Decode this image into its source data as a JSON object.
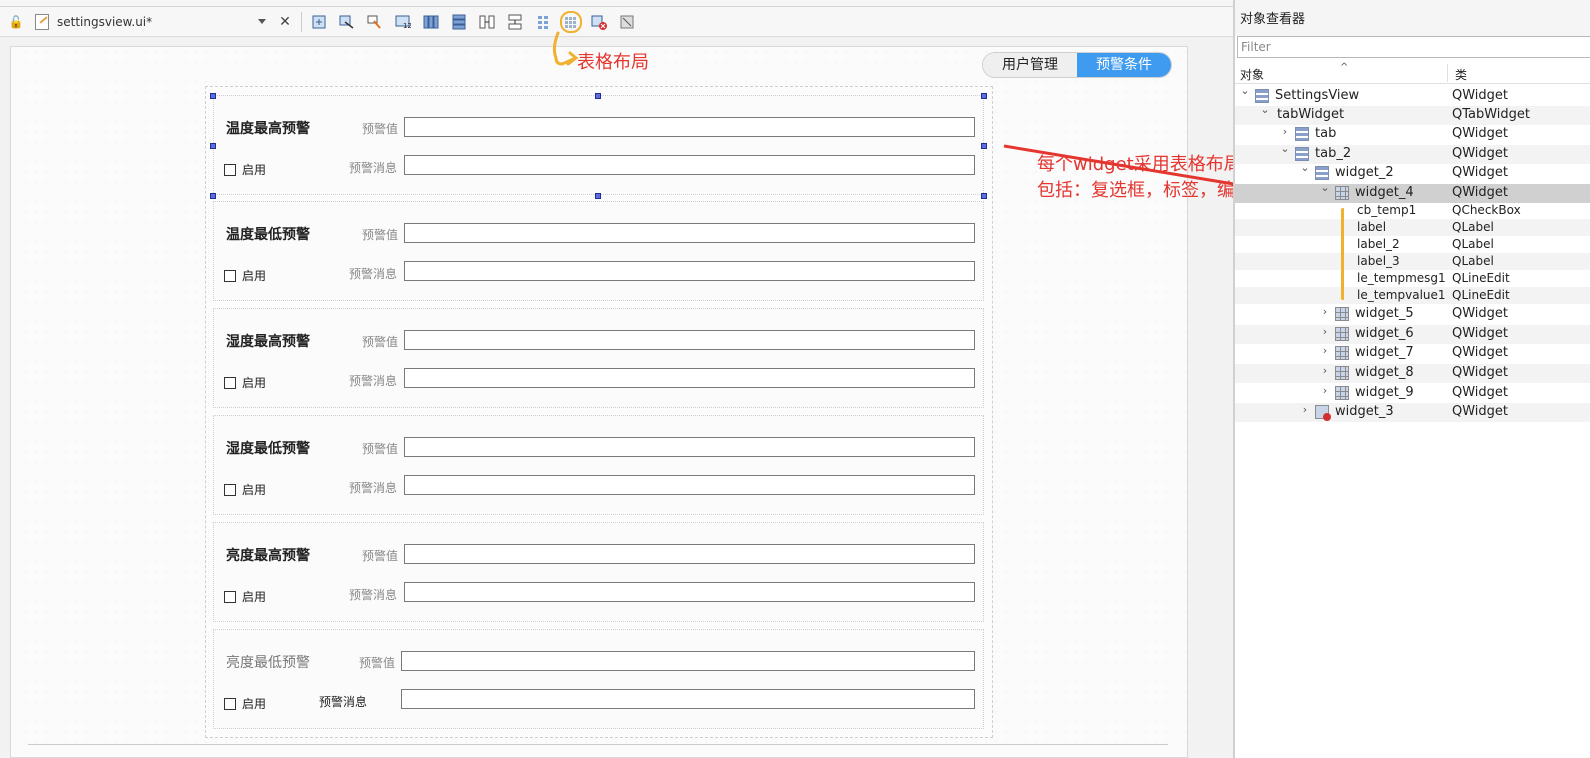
{
  "toolbar": {
    "file_name": "settingsview.ui*",
    "buttons": [
      "edit-widgets-icon",
      "edit-signals-icon",
      "edit-buddies-icon",
      "edit-tab-order-icon",
      "layout-horizontal-icon",
      "layout-vertical-icon",
      "layout-horizontal-splitter-icon",
      "layout-vertical-splitter-icon",
      "layout-form-icon",
      "layout-grid-icon",
      "break-layout-icon",
      "adjust-size-icon"
    ]
  },
  "annotations": {
    "grid_layout": "表格布局",
    "widget_line1": "每个widget采用表格布局",
    "widget_line2": "包括：复选框，标签，编辑框"
  },
  "tabs": {
    "user_management": "用户管理",
    "alarm_conditions": "预警条件",
    "active": "预警条件"
  },
  "alarms": [
    {
      "title": "温度最高预警",
      "value_label": "预警值",
      "message_label": "预警消息",
      "enable_label": "启用"
    },
    {
      "title": "温度最低预警",
      "value_label": "预警值",
      "message_label": "预警消息",
      "enable_label": "启用"
    },
    {
      "title": "湿度最高预警",
      "value_label": "预警值",
      "message_label": "预警消息",
      "enable_label": "启用"
    },
    {
      "title": "湿度最低预警",
      "value_label": "预警值",
      "message_label": "预警消息",
      "enable_label": "启用"
    },
    {
      "title": "亮度最高预警",
      "value_label": "预警值",
      "message_label": "预警消息",
      "enable_label": "启用"
    },
    {
      "title": "亮度最低预警",
      "value_label": "预警值",
      "message_label": "预警消息",
      "enable_label": "启用"
    }
  ],
  "inspector": {
    "title": "对象查看器",
    "filter_placeholder": "Filter",
    "col_object": "对象",
    "col_class": "类",
    "rows": [
      {
        "name": "SettingsView",
        "cls": "QWidget"
      },
      {
        "name": "tabWidget",
        "cls": "QTabWidget"
      },
      {
        "name": "tab",
        "cls": "QWidget"
      },
      {
        "name": "tab_2",
        "cls": "QWidget"
      },
      {
        "name": "widget_2",
        "cls": "QWidget"
      },
      {
        "name": "widget_4",
        "cls": "QWidget"
      },
      {
        "name": "cb_temp1",
        "cls": "QCheckBox"
      },
      {
        "name": "label",
        "cls": "QLabel"
      },
      {
        "name": "label_2",
        "cls": "QLabel"
      },
      {
        "name": "label_3",
        "cls": "QLabel"
      },
      {
        "name": "le_tempmesg1",
        "cls": "QLineEdit"
      },
      {
        "name": "le_tempvalue1",
        "cls": "QLineEdit"
      },
      {
        "name": "widget_5",
        "cls": "QWidget"
      },
      {
        "name": "widget_6",
        "cls": "QWidget"
      },
      {
        "name": "widget_7",
        "cls": "QWidget"
      },
      {
        "name": "widget_8",
        "cls": "QWidget"
      },
      {
        "name": "widget_9",
        "cls": "QWidget"
      },
      {
        "name": "widget_3",
        "cls": "QWidget"
      }
    ]
  },
  "colors": {
    "accent": "#3f9bf0",
    "annotation": "#e4352f",
    "highlight": "#f0b030"
  }
}
